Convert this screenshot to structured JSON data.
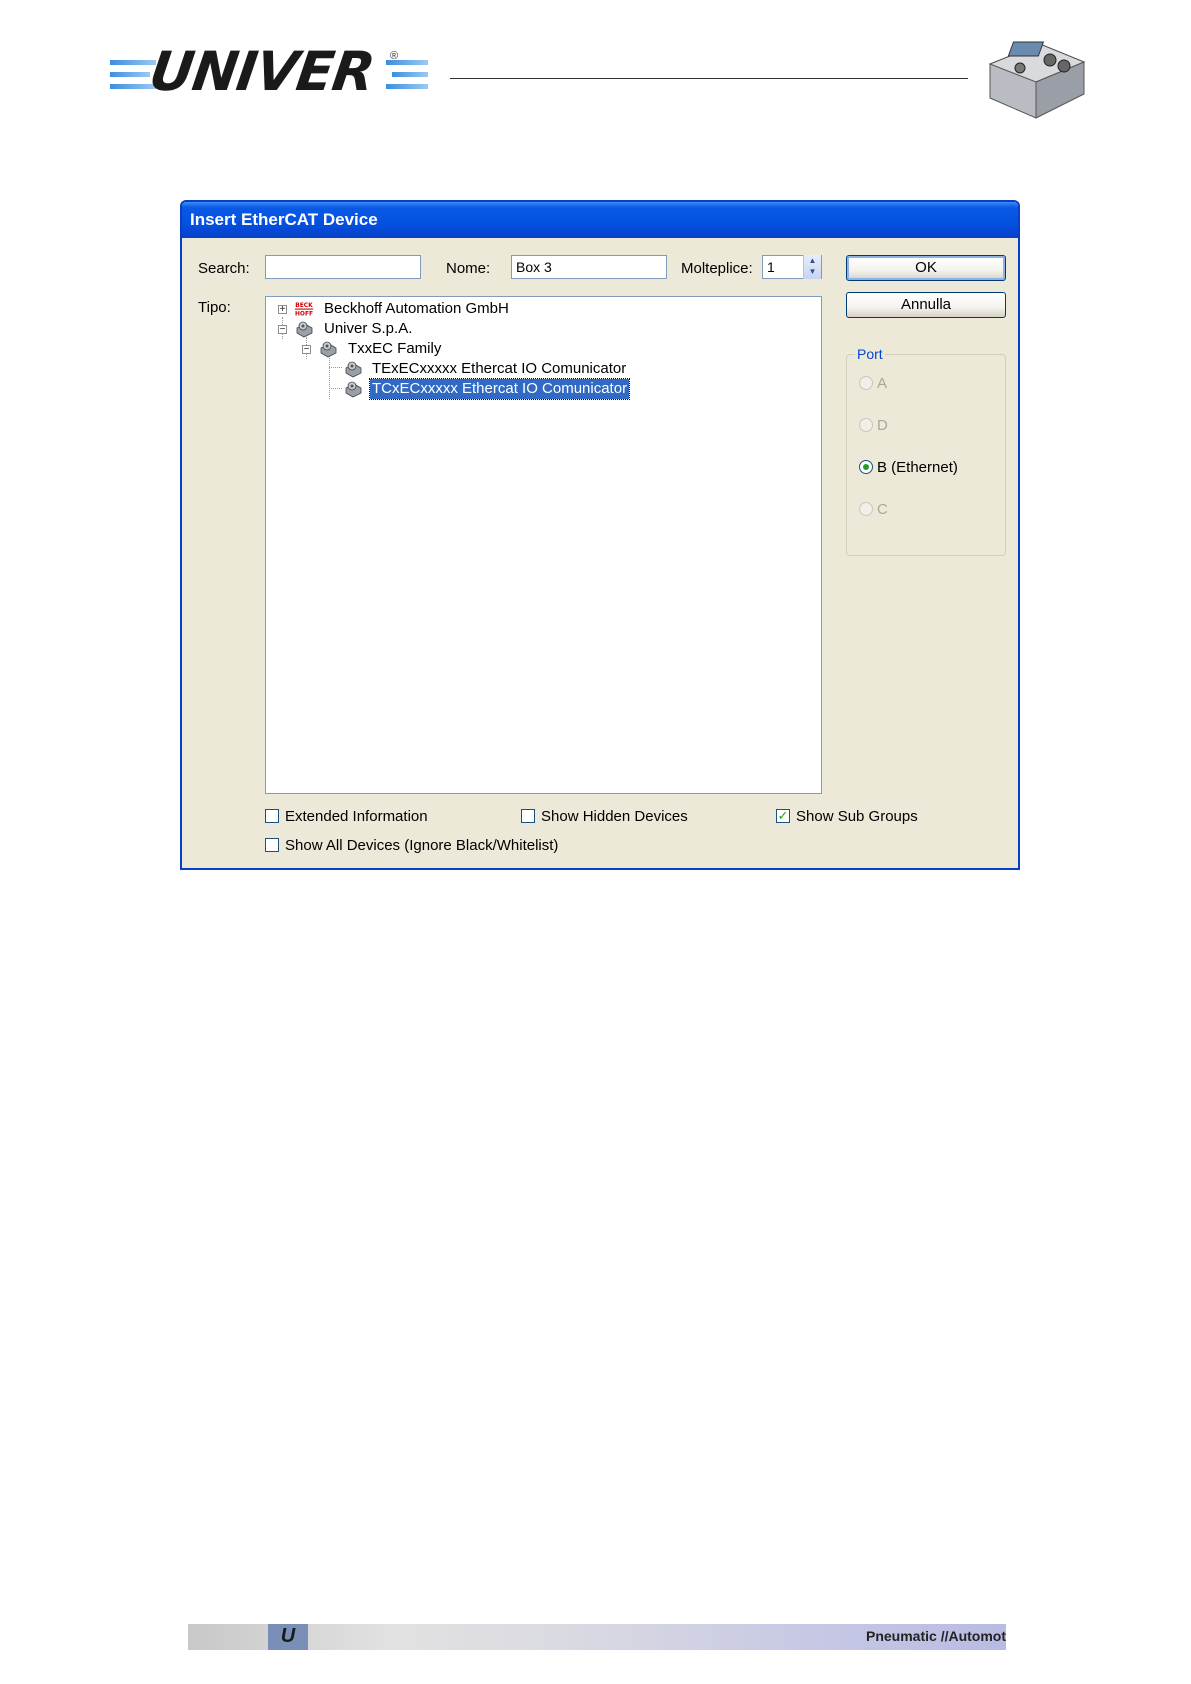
{
  "header": {
    "logo_text": "UNIVER",
    "logo_mark": "®"
  },
  "dialog": {
    "title": "Insert EtherCAT Device",
    "search": {
      "label": "Search:",
      "value": ""
    },
    "name": {
      "label": "Nome:",
      "value": "Box 3"
    },
    "multiple": {
      "label": "Molteplice:",
      "value": "1"
    },
    "type_label": "Tipo:",
    "ok_label": "OK",
    "cancel_label": "Annulla",
    "tree": [
      {
        "label": "Beckhoff Automation GmbH",
        "icon": "beckhoff-logo-icon",
        "expander": "+"
      },
      {
        "label": "Univer S.p.A.",
        "icon": "device-gear-icon",
        "expander": "−"
      },
      {
        "label": "TxxEC Family",
        "icon": "device-gear-icon",
        "expander": "−"
      },
      {
        "label": "TExECxxxxx Ethercat IO Comunicator",
        "icon": "device-gear-icon"
      },
      {
        "label": "TCxECxxxxx Ethercat IO Comunicator",
        "icon": "device-gear-icon",
        "selected": true
      }
    ],
    "beckhoff_icon_text": [
      "BECK",
      "HOFF"
    ],
    "port": {
      "title": "Port",
      "options": [
        {
          "label": "A",
          "enabled": false,
          "checked": false
        },
        {
          "label": "D",
          "enabled": false,
          "checked": false
        },
        {
          "label": "B (Ethernet)",
          "enabled": true,
          "checked": true
        },
        {
          "label": "C",
          "enabled": false,
          "checked": false
        }
      ]
    },
    "options": {
      "extended_info": {
        "label": "Extended Information",
        "checked": false
      },
      "show_hidden": {
        "label": "Show Hidden Devices",
        "checked": false
      },
      "show_sub_groups": {
        "label": "Show Sub Groups",
        "checked": true
      },
      "show_all": {
        "label": "Show All Devices (Ignore Black/Whitelist)",
        "checked": false
      }
    },
    "check_mark": "✓"
  },
  "footer": {
    "logo_text": "U",
    "text": "Pneumatic //Automoti"
  },
  "colors": {
    "title_bar": "#0550e0",
    "dialog_bg": "#ece9d8",
    "selection": "#316ac5",
    "accent_group": "#0046d5"
  }
}
